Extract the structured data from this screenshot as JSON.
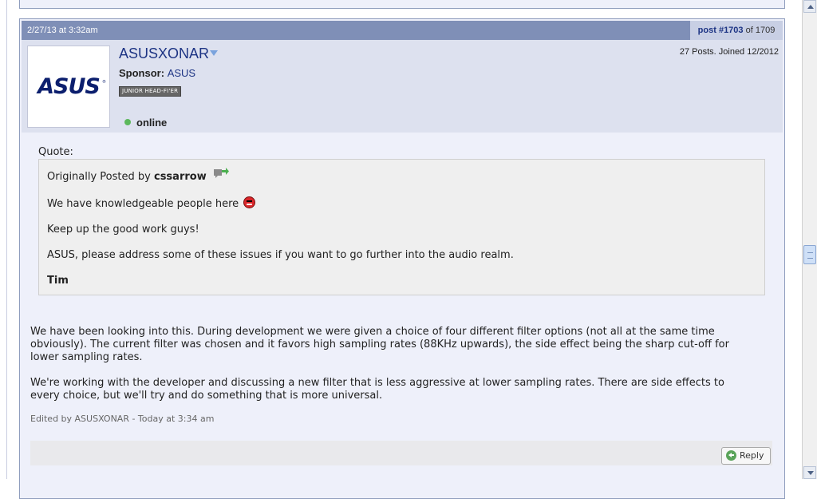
{
  "post": {
    "date": "2/27/13 at 3:32am",
    "post_link": "post #1703",
    "post_total": "of 1709",
    "user": {
      "name": "ASUSXONAR",
      "avatar_logo": "ASUS",
      "sponsor_label": "Sponsor:",
      "sponsor_name": "ASUS",
      "rank": "JUNIOR HEAD-FI'ER",
      "status": "online",
      "stats": "27 Posts. Joined 12/2012"
    },
    "quote": {
      "label": "Quote:",
      "originally_posted_by": "Originally Posted by",
      "author": "cssarrow",
      "lines": [
        "We have knowledgeable people here",
        "Keep up the good work guys!",
        "ASUS, please address some of these issues if you want to go further into the audio realm.",
        "Tim"
      ]
    },
    "body": [
      "We have been looking into this. During development we were given a choice of four different filter options (not all at the same time obviously). The current filter was chosen and it favors high sampling rates (88KHz upwards), the side effect being the sharp cut-off for lower sampling rates.",
      "We're working with the developer and discussing a new filter that is less aggressive at lower sampling rates. There are side effects to every choice, but we'll try and do something that is more universal."
    ],
    "edited": "Edited by ASUSXONAR - Today at 3:34 am",
    "reply_label": "Reply"
  },
  "colors": {
    "header_bg": "#7f8fb7",
    "user_panel_bg": "#dde1ef",
    "post_bg": "#eef0fa",
    "link": "#1d3484",
    "online": "#5cb85c"
  },
  "icons": {
    "dropdown": "triangle-down-icon",
    "view_post": "view-post-icon",
    "smiley": "angry-smiley-icon",
    "online": "online-dot-icon",
    "reply": "reply-icon"
  }
}
